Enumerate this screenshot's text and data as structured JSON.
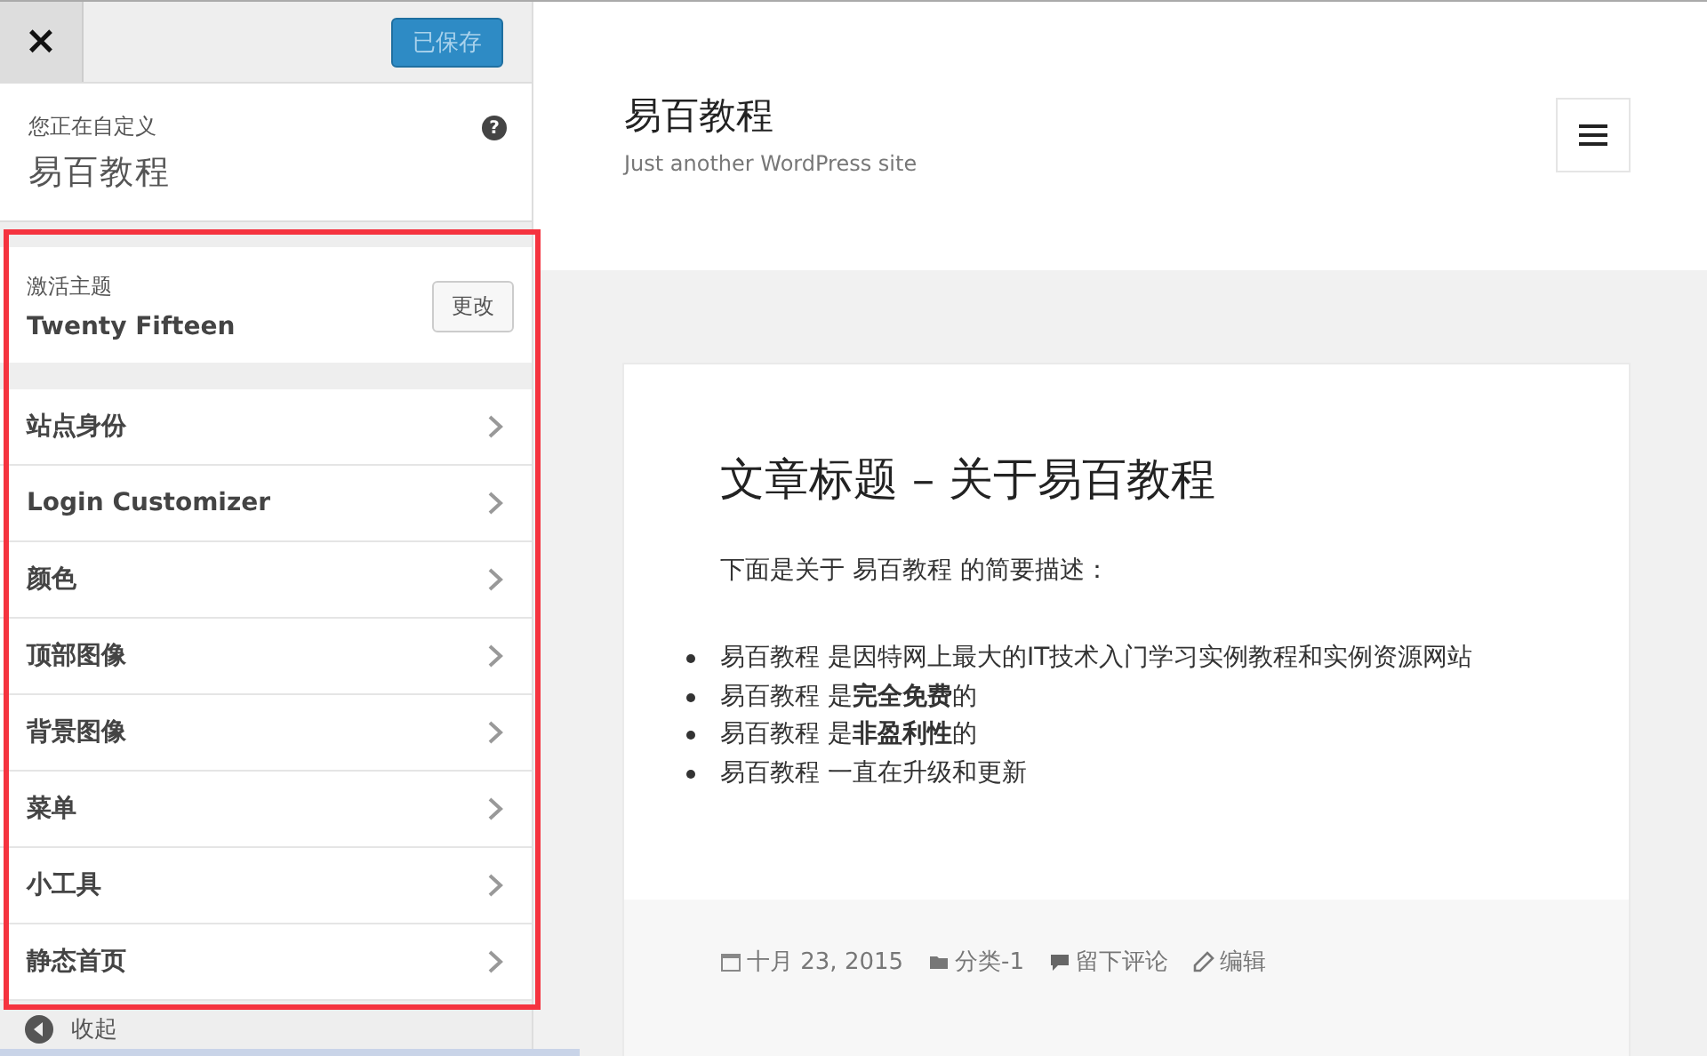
{
  "sidebar": {
    "close_label": "×",
    "save_button": {
      "label": "已保存",
      "disabled": true
    },
    "info": {
      "caption": "您正在自定义",
      "site_name": "易百教程",
      "help_icon": "?"
    },
    "theme": {
      "caption": "激活主题",
      "name": "Twenty Fifteen",
      "change_button": "更改"
    },
    "sections": [
      {
        "label": "站点身份"
      },
      {
        "label": "Login Customizer"
      },
      {
        "label": "颜色"
      },
      {
        "label": "顶部图像"
      },
      {
        "label": "背景图像"
      },
      {
        "label": "菜单"
      },
      {
        "label": "小工具"
      },
      {
        "label": "静态首页"
      }
    ],
    "collapse": {
      "label": "收起"
    }
  },
  "preview": {
    "site_title": "易百教程",
    "tagline": "Just another WordPress site",
    "post": {
      "title": "文章标题 – 关于易百教程",
      "intro": "下面是关于 易百教程 的简要描述：",
      "bullets": [
        "易百教程 是因特网上最大的IT技术入门学习实例教程和实例资源网站",
        "易百教程 是**完全免费**的",
        "易百教程 是**非盈利性**的",
        "易百教程 一直在升级和更新"
      ],
      "meta": [
        {
          "kind": "date",
          "text": "十月 23, 2015"
        },
        {
          "kind": "category",
          "text": "分类-1"
        },
        {
          "kind": "comment",
          "text": "留下评论"
        },
        {
          "kind": "edit",
          "text": "编辑"
        }
      ]
    }
  }
}
